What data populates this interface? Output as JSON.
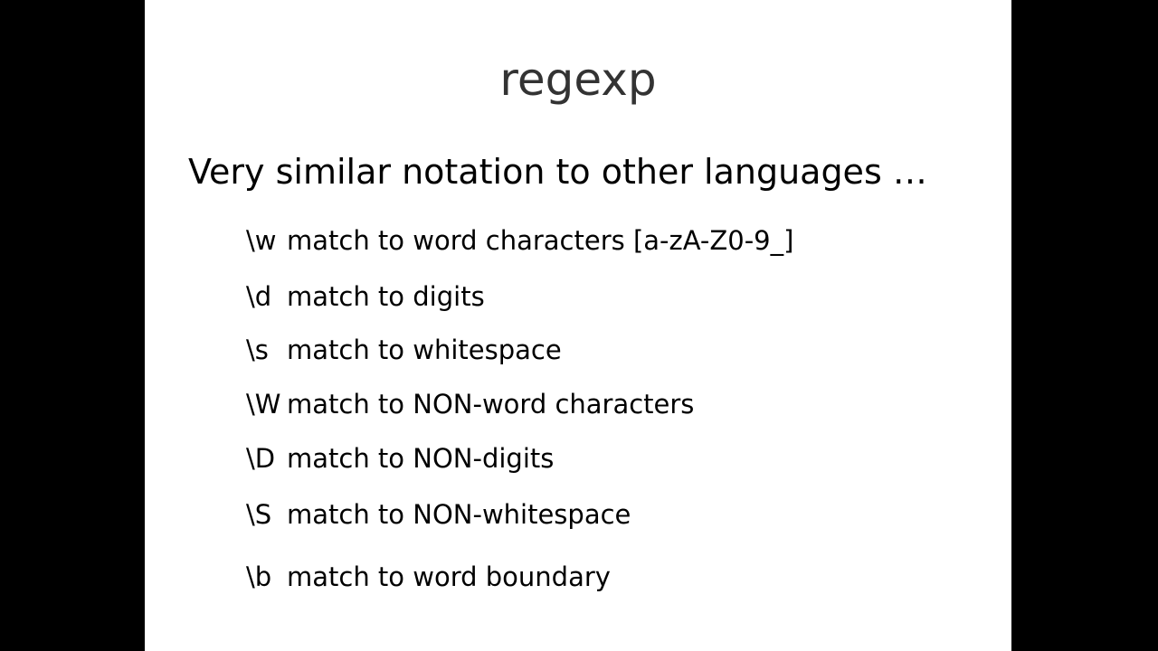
{
  "slide": {
    "title": "regexp",
    "subtitle": "Very similar notation to other languages …",
    "items": [
      {
        "code": "\\w",
        "desc": "match to word characters [a-zA-Z0-9_]"
      },
      {
        "code": "\\d",
        "desc": "match to digits"
      },
      {
        "code": "\\s",
        "desc": "match to whitespace"
      },
      {
        "code": "\\W",
        "desc": "match to NON-word characters"
      },
      {
        "code": "\\D",
        "desc": "match to NON-digits"
      },
      {
        "code": "\\S",
        "desc": "match to NON-whitespace"
      },
      {
        "code": "\\b",
        "desc": "match to word boundary"
      }
    ]
  }
}
